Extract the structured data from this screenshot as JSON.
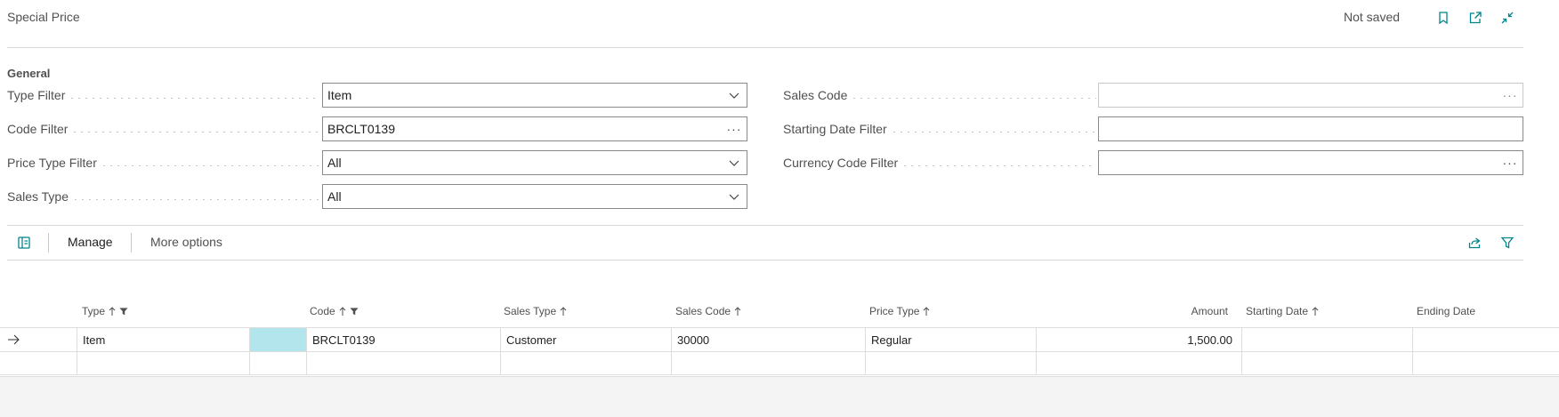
{
  "header": {
    "title": "Special Price",
    "status": "Not saved",
    "icons": [
      "bookmark-icon",
      "open-new-window-icon",
      "collapse-icon"
    ]
  },
  "general": {
    "title": "General",
    "left_fields": [
      {
        "label": "Type Filter",
        "value": "Item",
        "control": "dropdown"
      },
      {
        "label": "Code Filter",
        "value": "BRCLT0139",
        "control": "lookup"
      },
      {
        "label": "Price Type Filter",
        "value": "All",
        "control": "dropdown"
      },
      {
        "label": "Sales Type",
        "value": "All",
        "control": "dropdown"
      }
    ],
    "right_fields": [
      {
        "label": "Sales Code",
        "value": "",
        "control": "lookup-disabled"
      },
      {
        "label": "Starting Date Filter",
        "value": "",
        "control": "text"
      },
      {
        "label": "Currency Code Filter",
        "value": "",
        "control": "lookup"
      }
    ],
    "lookup_glyph": "···"
  },
  "actions": {
    "manage_label": "Manage",
    "more_options_label": "More options",
    "icons": [
      "layout-icon",
      "share-icon",
      "filter-icon"
    ]
  },
  "grid": {
    "columns": [
      {
        "label": "Type",
        "sorted": true,
        "filtered": true
      },
      {
        "label": "Code",
        "sorted": true,
        "filtered": true
      },
      {
        "label": "Sales Type",
        "sorted": true,
        "filtered": false
      },
      {
        "label": "Sales Code",
        "sorted": true,
        "filtered": false
      },
      {
        "label": "Price Type",
        "sorted": true,
        "filtered": false
      },
      {
        "label": "Amount",
        "sorted": false,
        "filtered": false
      },
      {
        "label": "Starting Date",
        "sorted": true,
        "filtered": false
      },
      {
        "label": "Ending Date",
        "sorted": false,
        "filtered": false
      }
    ],
    "rows": [
      {
        "type": "Item",
        "code": "BRCLT0139",
        "sales_type": "Customer",
        "sales_code": "30000",
        "price_type": "Regular",
        "amount": "1,500.00",
        "starting_date": "",
        "ending_date": ""
      },
      {
        "type": "",
        "code": "",
        "sales_type": "",
        "sales_code": "",
        "price_type": "",
        "amount": "",
        "starting_date": "",
        "ending_date": ""
      }
    ],
    "colors": {
      "selected_cell": "#b2e6ec",
      "accent": "#008489"
    }
  }
}
